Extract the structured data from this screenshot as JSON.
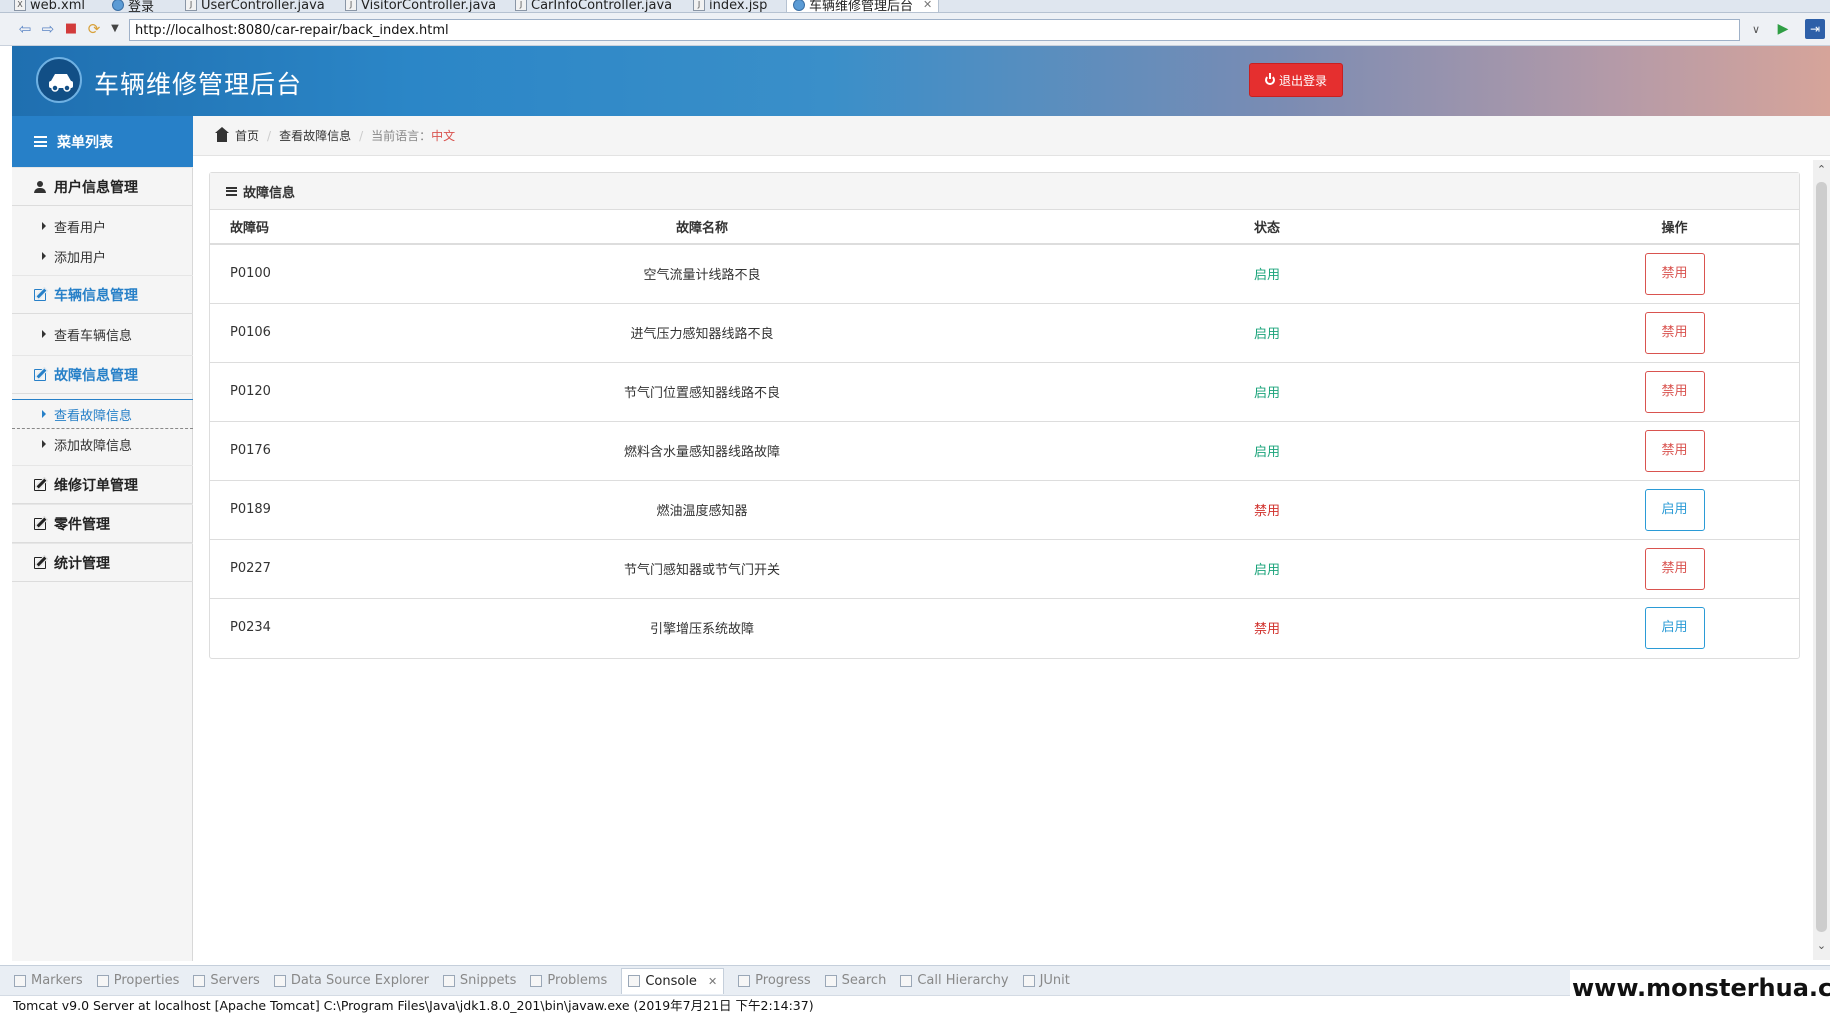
{
  "editor_tabs": [
    {
      "label": "web.xml",
      "icon": "xml-file-icon"
    },
    {
      "label": "登录",
      "icon": "globe-icon"
    },
    {
      "label": "UserController.java",
      "icon": "java-file-icon"
    },
    {
      "label": "VisitorController.java",
      "icon": "java-file-icon"
    },
    {
      "label": "CarInfoController.java",
      "icon": "java-file-icon"
    },
    {
      "label": "index.jsp",
      "icon": "jsp-file-icon"
    },
    {
      "label": "车辆维修管理后台",
      "icon": "globe-icon",
      "active": true
    }
  ],
  "browser": {
    "url": "http://localhost:8080/car-repair/back_index.html"
  },
  "header": {
    "title": "车辆维修管理后台",
    "logout_label": "退出登录",
    "logout_color": "#e52f2f"
  },
  "sidebar": {
    "menu_title": "菜单列表",
    "groups": [
      {
        "label": "用户信息管理",
        "items": [
          {
            "label": "查看用户"
          },
          {
            "label": "添加用户"
          }
        ]
      },
      {
        "label": "车辆信息管理",
        "items": [
          {
            "label": "查看车辆信息"
          }
        ]
      },
      {
        "label": "故障信息管理",
        "items": [
          {
            "label": "查看故障信息",
            "active": true
          },
          {
            "label": "添加故障信息"
          }
        ]
      },
      {
        "label": "维修订单管理",
        "items": []
      },
      {
        "label": "零件管理",
        "items": []
      },
      {
        "label": "统计管理",
        "items": []
      }
    ],
    "accent_color": "#2780c8"
  },
  "breadcrumb": {
    "home": "首页",
    "current": "查看故障信息",
    "lang_label": "当前语言：",
    "lang_value": "中文"
  },
  "panel": {
    "title": "故障信息",
    "columns": [
      "故障码",
      "故障名称",
      "状态",
      "操作"
    ],
    "rows": [
      {
        "code": "P0100",
        "name": "空气流量计线路不良",
        "status": "启用",
        "action": "禁用"
      },
      {
        "code": "P0106",
        "name": "进气压力感知器线路不良",
        "status": "启用",
        "action": "禁用"
      },
      {
        "code": "P0120",
        "name": "节气门位置感知器线路不良",
        "status": "启用",
        "action": "禁用"
      },
      {
        "code": "P0176",
        "name": "燃料含水量感知器线路故障",
        "status": "启用",
        "action": "禁用"
      },
      {
        "code": "P0189",
        "name": "燃油温度感知器",
        "status": "禁用",
        "action": "启用"
      },
      {
        "code": "P0227",
        "name": "节气门感知器或节气门开关",
        "status": "启用",
        "action": "禁用"
      },
      {
        "code": "P0234",
        "name": "引擎增压系统故障",
        "status": "禁用",
        "action": "启用"
      }
    ],
    "status_on_color": "#1aa37a",
    "status_off_color": "#d0302b"
  },
  "console": {
    "tabs": [
      {
        "label": "Markers"
      },
      {
        "label": "Properties"
      },
      {
        "label": "Servers"
      },
      {
        "label": "Data Source Explorer"
      },
      {
        "label": "Snippets"
      },
      {
        "label": "Problems"
      },
      {
        "label": "Console",
        "active": true
      },
      {
        "label": "Progress"
      },
      {
        "label": "Search"
      },
      {
        "label": "Call Hierarchy"
      },
      {
        "label": "JUnit"
      }
    ],
    "output": "Tomcat v9.0 Server at localhost [Apache Tomcat] C:\\Program Files\\Java\\jdk1.8.0_201\\bin\\javaw.exe (2019年7月21日 下午2:14:37)"
  },
  "watermark": "www.monsterhua.com"
}
